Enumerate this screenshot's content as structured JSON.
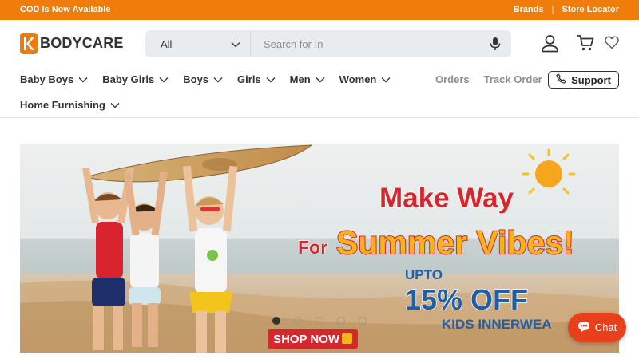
{
  "topbar": {
    "announcement": "COD Is Now Available",
    "links": [
      "Brands",
      "Store Locator"
    ],
    "separator": "|"
  },
  "brand": {
    "name": "BODYCARE",
    "logo_letter": "K"
  },
  "search": {
    "category": "All",
    "placeholder": "Search for In",
    "icons": [
      "chevron-down-icon",
      "microphone-icon"
    ]
  },
  "header_icons": [
    "user-icon",
    "cart-icon",
    "heart-icon"
  ],
  "nav": {
    "items": [
      "Baby Boys",
      "Baby Girls",
      "Boys",
      "Girls",
      "Men",
      "Women",
      "Home Furnishing"
    ],
    "orders": "Orders",
    "track_order": "Track Order",
    "support": "Support"
  },
  "banner": {
    "headline_1": "Make Way",
    "headline_for": "For",
    "headline_2": "Summer Vibes!",
    "offer_prefix": "UPTO",
    "offer": "15% OFF",
    "offer_sub": "KIDS INNERWEA",
    "cta": "SHOP NOW",
    "slide_count": 5,
    "active_slide": 1
  },
  "chat": {
    "label": "Chat"
  },
  "colors": {
    "accent": "#f07c0c",
    "chat": "#e8401c",
    "offer_blue": "#1f5fa8",
    "headline_red": "#d6262e"
  }
}
